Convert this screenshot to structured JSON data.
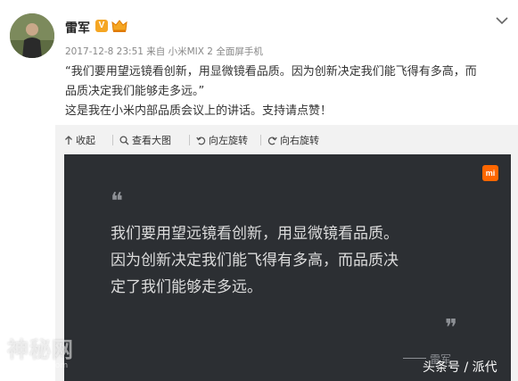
{
  "post": {
    "author": "雷军",
    "verified_badge": "V",
    "meta": "2017-12-8 23:51 来自 小米MIX 2 全面屏手机",
    "text_lines": [
      "“我们要用望远镜看创新，用显微镜看品质。因为创新决定我们能飞得有多高，而",
      "品质决定我们能够走多远。”",
      "这是我在小米内部品质会议上的讲话。支持请点赞！"
    ]
  },
  "toolbar": {
    "collapse": "收起",
    "view_large": "查看大图",
    "rotate_left": "向左旋转",
    "rotate_right": "向右旋转"
  },
  "image": {
    "logo": "mi",
    "quote_open": "❝",
    "quote_close": "❞",
    "quote_lines": [
      "我们要用望远镜看创新，用显微镜看品质。",
      "因为创新决定我们能飞得有多高，而品质决",
      "定了我们能够走多远。"
    ],
    "signature": "雷军"
  },
  "watermarks": {
    "left": "神秘网",
    "left_url": "www.smw.com",
    "right": "头条号 / 派代"
  },
  "colors": {
    "badge": "#f5a623",
    "mi_orange": "#ff6700",
    "card_bg": "#2c2f33",
    "panel_bg": "#f2f2f2"
  },
  "icons": [
    "crown-icon",
    "chevron-down-icon",
    "arrow-up-icon",
    "magnifier-icon",
    "rotate-left-icon",
    "rotate-right-icon"
  ]
}
